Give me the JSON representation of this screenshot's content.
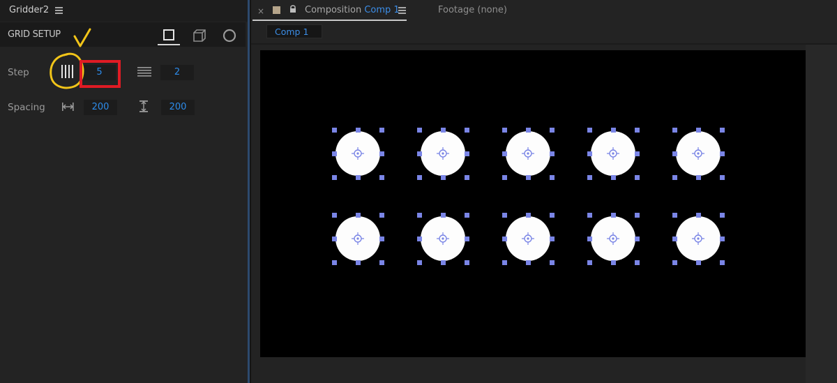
{
  "left_panel": {
    "title": "Gridder2",
    "section_title": "GRID SETUP",
    "modes": [
      {
        "name": "square",
        "active": true
      },
      {
        "name": "cube",
        "active": false
      },
      {
        "name": "circle",
        "active": false
      }
    ],
    "step": {
      "label": "Step",
      "columns_value": "5",
      "rows_value": "2"
    },
    "spacing": {
      "label": "Spacing",
      "horizontal_value": "200",
      "vertical_value": "200"
    },
    "annotations": {
      "highlight_color": "#f2c519",
      "box_color": "#e01b24"
    }
  },
  "composition_panel": {
    "tab_prefix": "Composition",
    "tab_comp_name": "Comp 1",
    "footage_tab": "Footage (none)",
    "comp_chip": "Comp 1",
    "accent": "#3c8ee8",
    "layer_grid": {
      "columns": 5,
      "rows": 2,
      "handle_color": "#7a85e6"
    }
  }
}
